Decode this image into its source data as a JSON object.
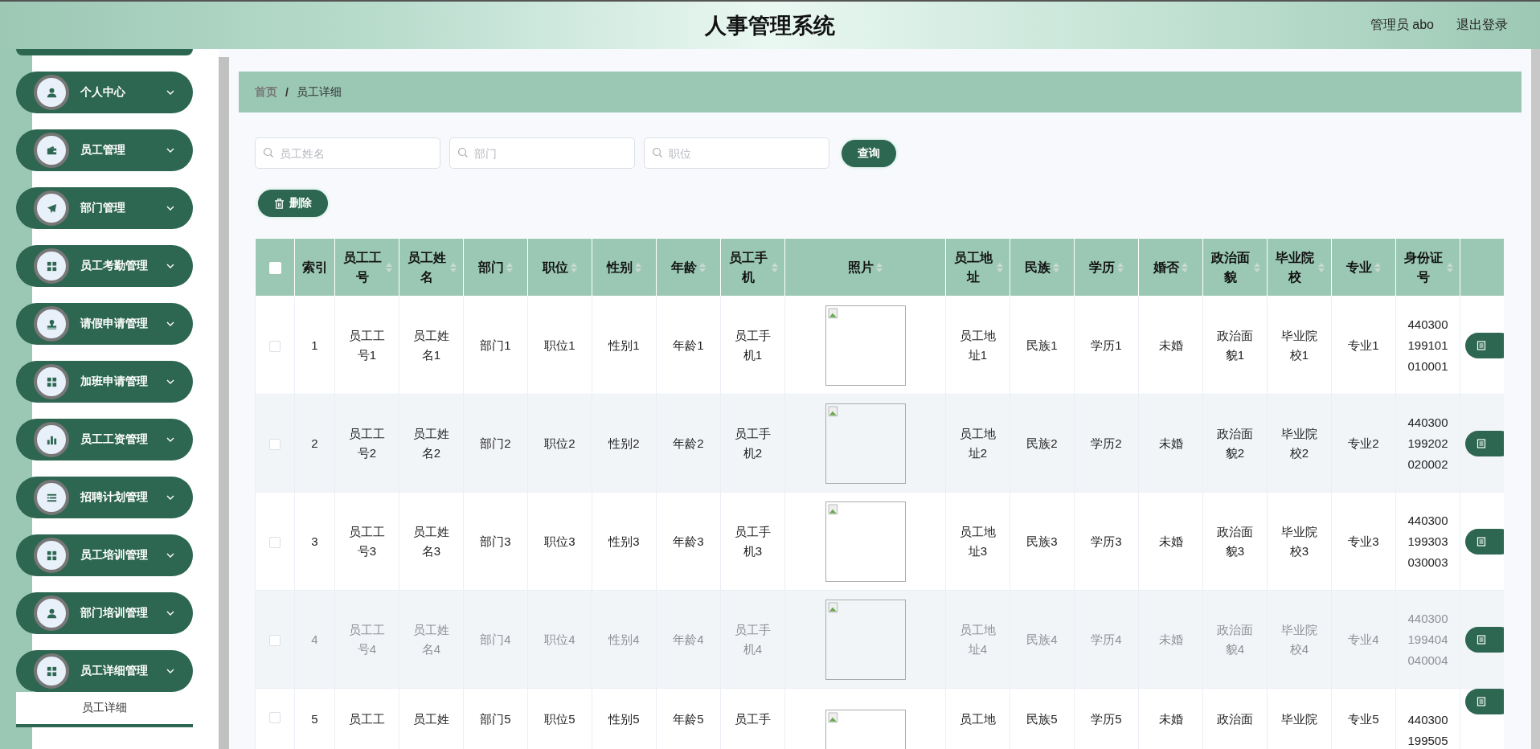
{
  "header": {
    "title": "人事管理系统",
    "user": "管理员 abo",
    "logout": "退出登录"
  },
  "sidebar": {
    "items": [
      {
        "label": "个人中心"
      },
      {
        "label": "员工管理"
      },
      {
        "label": "部门管理"
      },
      {
        "label": "员工考勤管理"
      },
      {
        "label": "请假申请管理"
      },
      {
        "label": "加班申请管理"
      },
      {
        "label": "员工工资管理"
      },
      {
        "label": "招聘计划管理"
      },
      {
        "label": "员工培训管理"
      },
      {
        "label": "部门培训管理"
      },
      {
        "label": "员工详细管理",
        "children": [
          {
            "label": "员工详细",
            "selected": true
          }
        ]
      }
    ]
  },
  "breadcrumb": {
    "separator": "/",
    "items": [
      {
        "label": "首页",
        "current": false
      },
      {
        "label": "员工详细",
        "current": true
      }
    ]
  },
  "search": {
    "fields": [
      {
        "placeholder": "员工姓名"
      },
      {
        "placeholder": "部门"
      },
      {
        "placeholder": "职位"
      }
    ],
    "button": "查询"
  },
  "delete_button": "删除",
  "table": {
    "header_checked": false,
    "columns": [
      {
        "label": "索引",
        "kind": "text",
        "sortable": false
      },
      {
        "label": "员工工号",
        "kind": "text",
        "sortable": true
      },
      {
        "label": "员工姓名",
        "kind": "text",
        "sortable": true
      },
      {
        "label": "部门",
        "kind": "text",
        "sortable": true
      },
      {
        "label": "职位",
        "kind": "text",
        "sortable": true
      },
      {
        "label": "性别",
        "kind": "text",
        "sortable": true
      },
      {
        "label": "年龄",
        "kind": "text",
        "sortable": true
      },
      {
        "label": "员工手机",
        "kind": "text",
        "sortable": true
      },
      {
        "label": "照片",
        "kind": "photo",
        "sortable": true
      },
      {
        "label": "员工地址",
        "kind": "text",
        "sortable": true
      },
      {
        "label": "民族",
        "kind": "text",
        "sortable": true
      },
      {
        "label": "学历",
        "kind": "text",
        "sortable": true
      },
      {
        "label": "婚否",
        "kind": "text",
        "sortable": true
      },
      {
        "label": "政治面貌",
        "kind": "text",
        "sortable": true
      },
      {
        "label": "毕业院校",
        "kind": "text",
        "sortable": true
      },
      {
        "label": "专业",
        "kind": "text",
        "sortable": true
      },
      {
        "label": "身份证号",
        "kind": "id",
        "sortable": true
      },
      {
        "kind": "action"
      }
    ],
    "rows": [
      {
        "checked": false,
        "faded": false,
        "cells": [
          "1",
          "员工工号1",
          "员工姓名1",
          "部门1",
          "职位1",
          "性别1",
          "年龄1",
          "员工手机1",
          "",
          "员工地址1",
          "民族1",
          "学历1",
          "未婚",
          "政治面貌1",
          "毕业院校1",
          "专业1",
          "440300199101010001"
        ]
      },
      {
        "checked": false,
        "faded": false,
        "cells": [
          "2",
          "员工工号2",
          "员工姓名2",
          "部门2",
          "职位2",
          "性别2",
          "年龄2",
          "员工手机2",
          "",
          "员工地址2",
          "民族2",
          "学历2",
          "未婚",
          "政治面貌2",
          "毕业院校2",
          "专业2",
          "440300199202020002"
        ]
      },
      {
        "checked": false,
        "faded": false,
        "cells": [
          "3",
          "员工工号3",
          "员工姓名3",
          "部门3",
          "职位3",
          "性别3",
          "年龄3",
          "员工手机3",
          "",
          "员工地址3",
          "民族3",
          "学历3",
          "未婚",
          "政治面貌3",
          "毕业院校3",
          "专业3",
          "440300199303030003"
        ]
      },
      {
        "checked": false,
        "faded": true,
        "cells": [
          "4",
          "员工工号4",
          "员工姓名4",
          "部门4",
          "职位4",
          "性别4",
          "年龄4",
          "员工手机4",
          "",
          "员工地址4",
          "民族4",
          "学历4",
          "未婚",
          "政治面貌4",
          "毕业院校4",
          "专业4",
          "440300199404040004"
        ]
      },
      {
        "checked": false,
        "faded": false,
        "cells": [
          "5",
          "员工工",
          "员工姓",
          "部门5",
          "职位5",
          "性别5",
          "年龄5",
          "员工手",
          "",
          "员工地",
          "民族5",
          "学历5",
          "未婚",
          "政治面",
          "毕业院",
          "专业5",
          "440300199505"
        ]
      }
    ]
  }
}
